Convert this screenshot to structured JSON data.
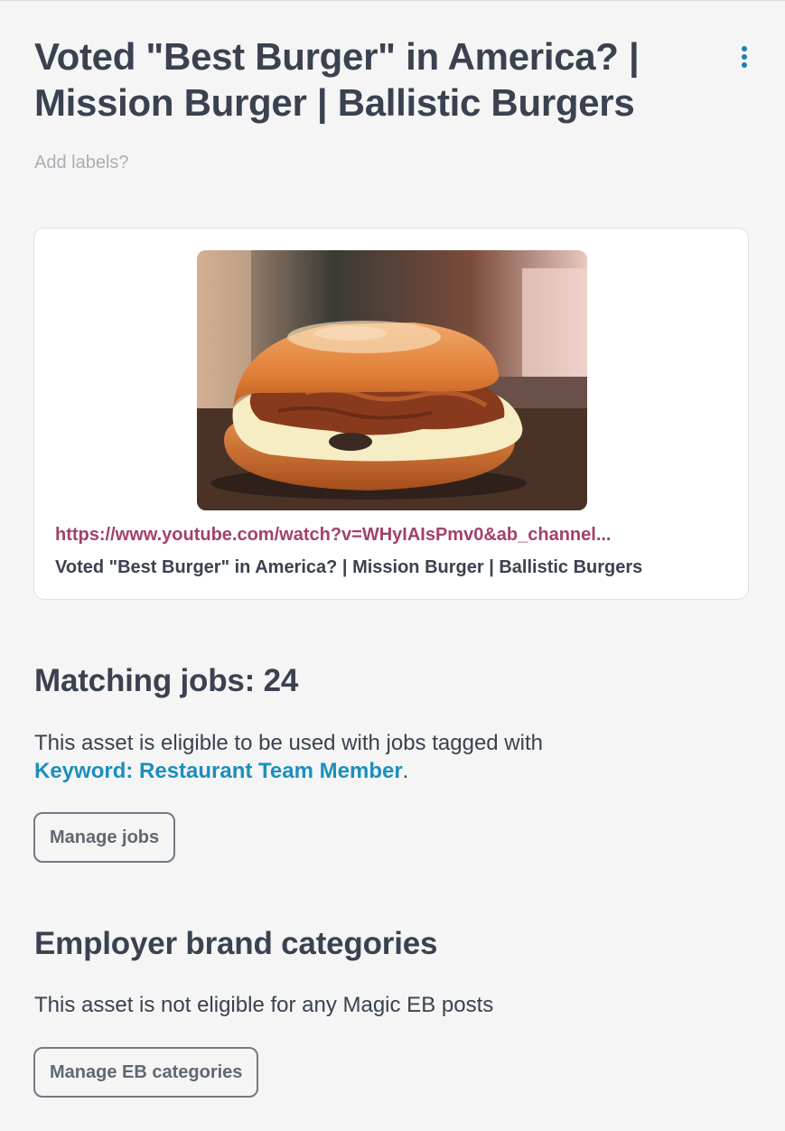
{
  "asset": {
    "title": "Voted \"Best Burger\" in America? | Mission Burger | Ballistic Burgers",
    "menu_icon": "more-vertical-icon",
    "add_labels_link": "Add labels?"
  },
  "link_preview": {
    "thumbnail_icon": "burger-photo",
    "url": "https://www.youtube.com/watch?v=WHyIAIsPmv0&ab_channel...",
    "caption": "Voted \"Best Burger\" in America? | Mission Burger | Ballistic Burgers"
  },
  "matching_jobs": {
    "heading": "Matching jobs: 24",
    "description_prefix": "This asset is eligible to be used with jobs tagged with",
    "keyword_link": "Keyword: Restaurant Team Member",
    "description_suffix": ".",
    "button_label": "Manage jobs"
  },
  "employer_brand": {
    "heading": "Employer brand categories",
    "description": "This asset is not eligible for any Magic EB posts",
    "button_label": "Manage EB categories"
  },
  "colors": {
    "background": "#f5f5f5",
    "text": "#3a4250",
    "accent_blue": "#1b8fbd",
    "url_magenta": "#a3416a",
    "muted": "#a9afb6"
  }
}
